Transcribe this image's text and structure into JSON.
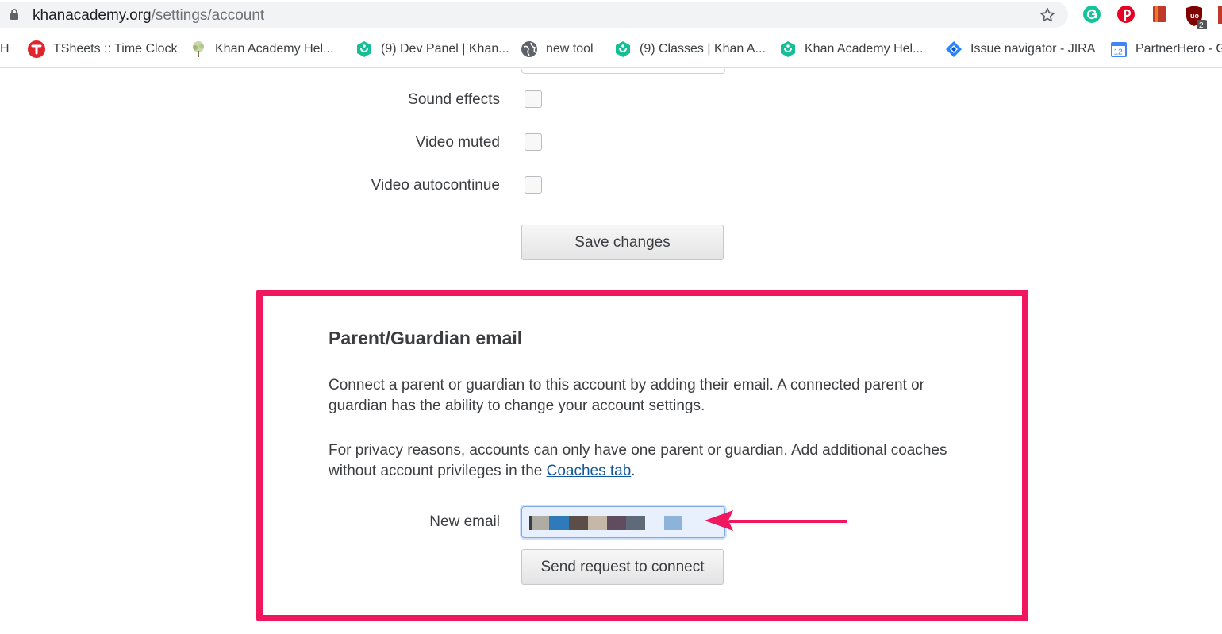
{
  "browser": {
    "url_domain": "khanacademy.org",
    "url_path": "/settings/account",
    "extensions": [
      "grammarly-icon",
      "pinterest-icon",
      "bookmark-extension-icon",
      "ublock-icon"
    ],
    "ublock_badge": "2"
  },
  "bookmarks": [
    {
      "label": "H",
      "icon": "none"
    },
    {
      "label": "TSheets :: Time Clock",
      "icon": "tsheets-icon"
    },
    {
      "label": "Khan Academy Hel...",
      "icon": "tree-icon"
    },
    {
      "label": "(9) Dev Panel | Khan...",
      "icon": "khan-icon"
    },
    {
      "label": "new tool",
      "icon": "globe-icon"
    },
    {
      "label": "(9) Classes | Khan A...",
      "icon": "khan-icon"
    },
    {
      "label": "Khan Academy Hel...",
      "icon": "khan-icon"
    },
    {
      "label": "Issue navigator - JIRA",
      "icon": "jira-icon"
    },
    {
      "label": "PartnerHero - G",
      "icon": "calendar-icon",
      "calendar_day": "12"
    }
  ],
  "settings": {
    "sound_effects_label": "Sound effects",
    "video_muted_label": "Video muted",
    "video_autocontinue_label": "Video autocontinue",
    "save_button": "Save changes"
  },
  "guardian": {
    "title": "Parent/Guardian email",
    "description": "Connect a parent or guardian to this account by adding their email. A connected parent or guardian has the ability to change your account settings.",
    "privacy_text": "For privacy reasons, accounts can only have one parent or guardian. Add additional coaches without account privileges in the ",
    "coaches_link": "Coaches tab",
    "privacy_end": ".",
    "new_email_label": "New email",
    "send_button": "Send request to connect"
  },
  "colors": {
    "highlight_border": "#f0175f",
    "arrow": "#f0175f",
    "link": "#11579e"
  }
}
